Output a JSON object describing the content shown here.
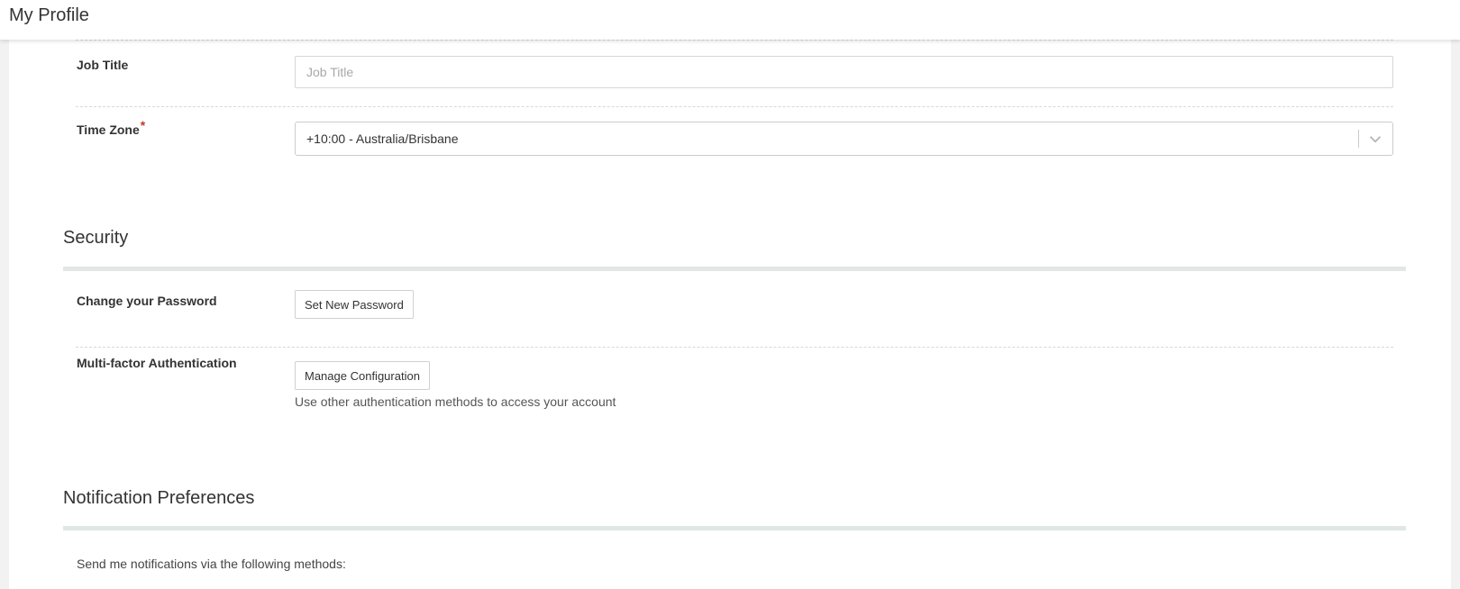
{
  "header": {
    "title": "My Profile"
  },
  "profile": {
    "job_title_label": "Job Title",
    "job_title_placeholder": "Job Title",
    "job_title_value": "",
    "time_zone_label": "Time Zone",
    "time_zone_required_mark": "*",
    "time_zone_value": "+10:00 - Australia/Brisbane"
  },
  "security": {
    "title": "Security",
    "password_label": "Change your Password",
    "password_button": "Set New Password",
    "mfa_label": "Multi-factor Authentication",
    "mfa_button": "Manage Configuration",
    "mfa_help": "Use other authentication methods to access your account"
  },
  "notifications": {
    "title": "Notification Preferences",
    "intro": "Send me notifications via the following methods:"
  },
  "colors": {
    "required": "#c0392b",
    "section_rule": "#e1e6e6",
    "page_background": "#f2f2f2"
  },
  "icons": {
    "select_chevron": "chevron-down-icon"
  }
}
